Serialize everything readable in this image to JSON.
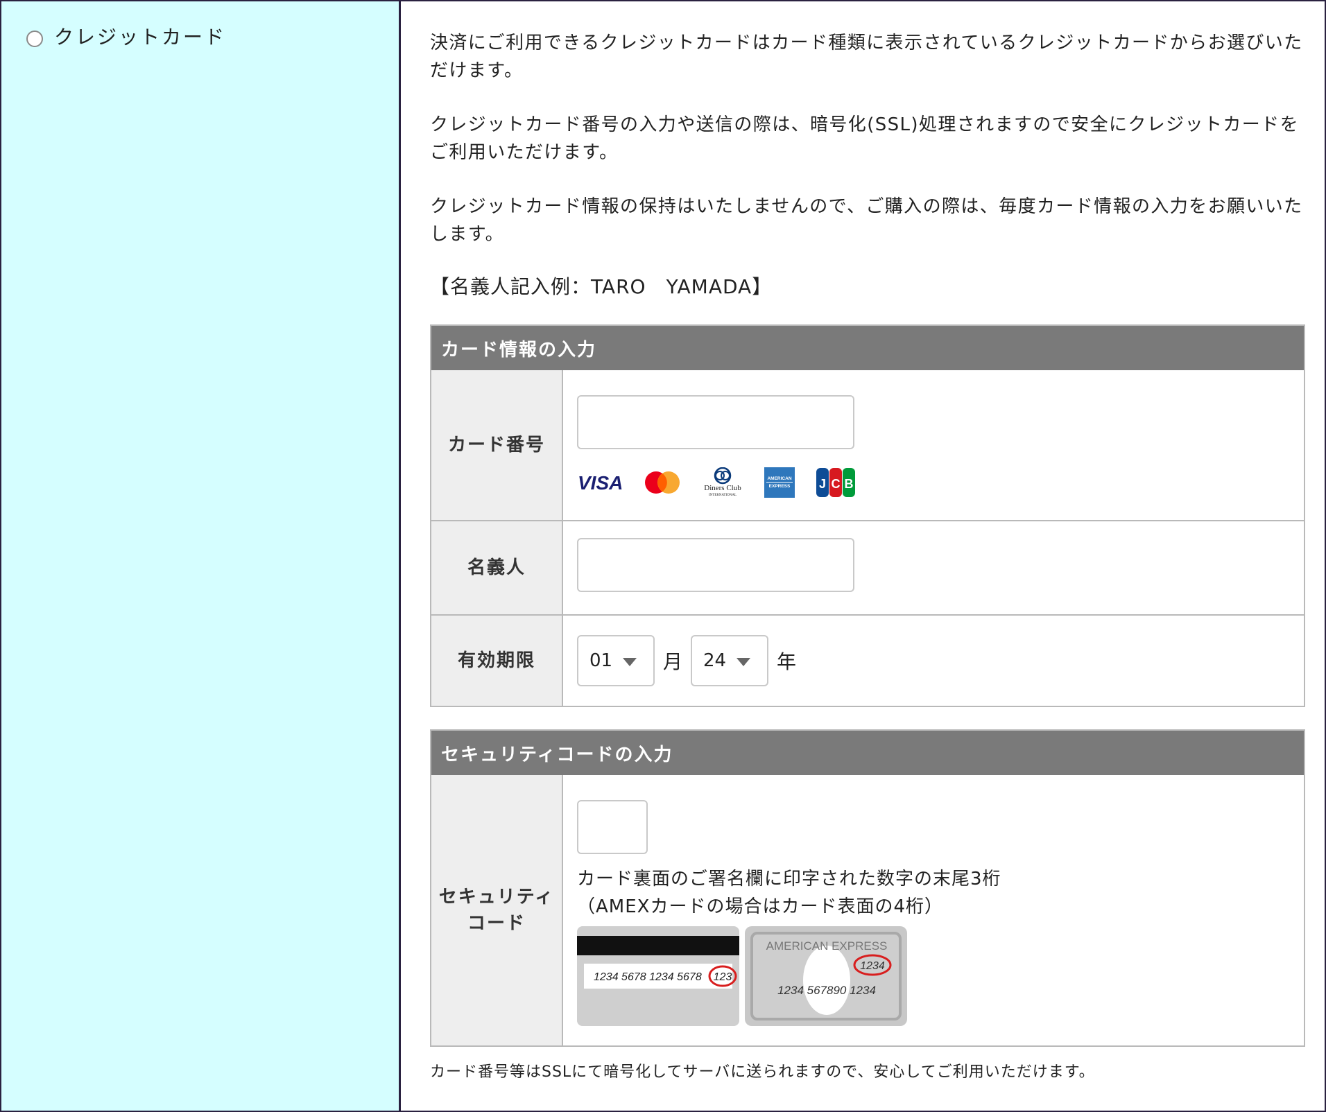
{
  "payment_method": {
    "label": "クレジットカード",
    "selected": false
  },
  "intro": {
    "paragraphs": [
      "決済にご利用できるクレジットカードはカード種類に表示されているクレジットカードからお選びいただけます。",
      "クレジットカード番号の入力や送信の際は、暗号化(SSL)処理されますので安全にクレジットカードをご利用いただけます。",
      "クレジットカード情報の保持はいたしませんので、ご購入の際は、毎度カード情報の入力をお願いいたします。"
    ],
    "name_example": "【名義人記入例：TARO　YAMADA】"
  },
  "card_panel": {
    "title": "カード情報の入力",
    "card_number_label": "カード番号",
    "card_number_value": "",
    "brands": [
      "VISA",
      "Mastercard",
      "Diners Club",
      "American Express",
      "JCB"
    ],
    "holder_label": "名義人",
    "holder_value": "",
    "expiry_label": "有効期限",
    "expiry_month": "01",
    "month_unit": "月",
    "expiry_year": "24",
    "year_unit": "年"
  },
  "security_panel": {
    "title": "セキュリティコードの入力",
    "label_line1": "セキュリティ",
    "label_line2": "コード",
    "value": "",
    "desc_line1": "カード裏面のご署名欄に印字された数字の末尾3桁",
    "desc_line2": "（AMEXカードの場合はカード表面の4桁）",
    "sample_back_number": "1234 5678 1234 5678",
    "sample_back_code": "123",
    "sample_amex_title": "AMERICAN EXPRESS",
    "sample_amex_code": "1234",
    "sample_amex_number": "1234 567890 1234"
  },
  "footnote": "カード番号等はSSLにて暗号化してサーバに送られますので、安心してご利用いただけます。",
  "colors": {
    "left_bg": "#d5feff",
    "panel_header": "#7a7a7a",
    "label_bg": "#eeeeee",
    "visa_blue": "#1a1f71",
    "mc_red": "#eb001b",
    "mc_orange": "#f79e1b",
    "amex_blue": "#2e77bc",
    "jcb_blue": "#0e4c96",
    "jcb_red": "#d71920",
    "jcb_green": "#009b3a"
  }
}
